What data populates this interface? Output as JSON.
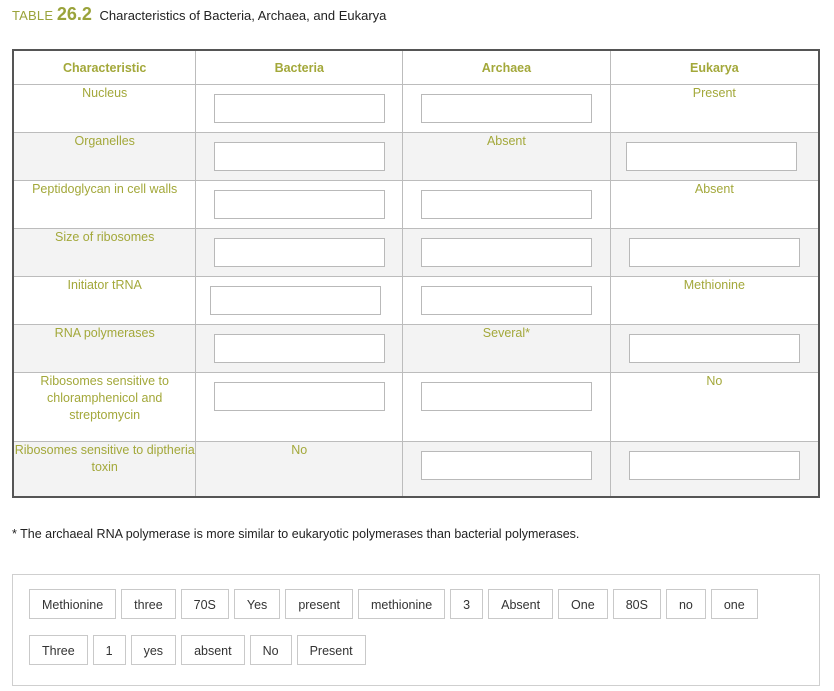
{
  "caption": {
    "label": "TABLE",
    "number": "26.2",
    "title": "Characteristics of Bacteria, Archaea, and Eukarya"
  },
  "headers": [
    "Characteristic",
    "Bacteria",
    "Archaea",
    "Eukarya"
  ],
  "rows": [
    {
      "characteristic": "Nucleus",
      "bacteria": "",
      "archaea": "",
      "eukarya": "Present"
    },
    {
      "characteristic": "Organelles",
      "bacteria": "",
      "archaea": "Absent",
      "eukarya": ""
    },
    {
      "characteristic": "Peptidoglycan in cell walls",
      "bacteria": "",
      "archaea": "",
      "eukarya": "Absent"
    },
    {
      "characteristic": "Size of ribosomes",
      "bacteria": "",
      "archaea": "",
      "eukarya": ""
    },
    {
      "characteristic": "Initiator tRNA",
      "bacteria": "",
      "archaea": "",
      "eukarya": "Methionine"
    },
    {
      "characteristic": "RNA polymerases",
      "bacteria": "",
      "archaea": "Several*",
      "eukarya": ""
    },
    {
      "characteristic": "Ribosomes sensitive to chloramphenicol and streptomycin",
      "bacteria": "",
      "archaea": "",
      "eukarya": "No"
    },
    {
      "characteristic": "Ribosomes sensitive to diptheria toxin",
      "bacteria": "No",
      "archaea": "",
      "eukarya": ""
    }
  ],
  "footnote": "* The archaeal RNA polymerase is more similar to eukaryotic polymerases than bacterial polymerases.",
  "word_bank": [
    "Methionine",
    "three",
    "70S",
    "Yes",
    "present",
    "methionine",
    "3",
    "Absent",
    "One",
    "80S",
    "no",
    "one",
    "Three",
    "1",
    "yes",
    "absent",
    "No",
    "Present"
  ]
}
